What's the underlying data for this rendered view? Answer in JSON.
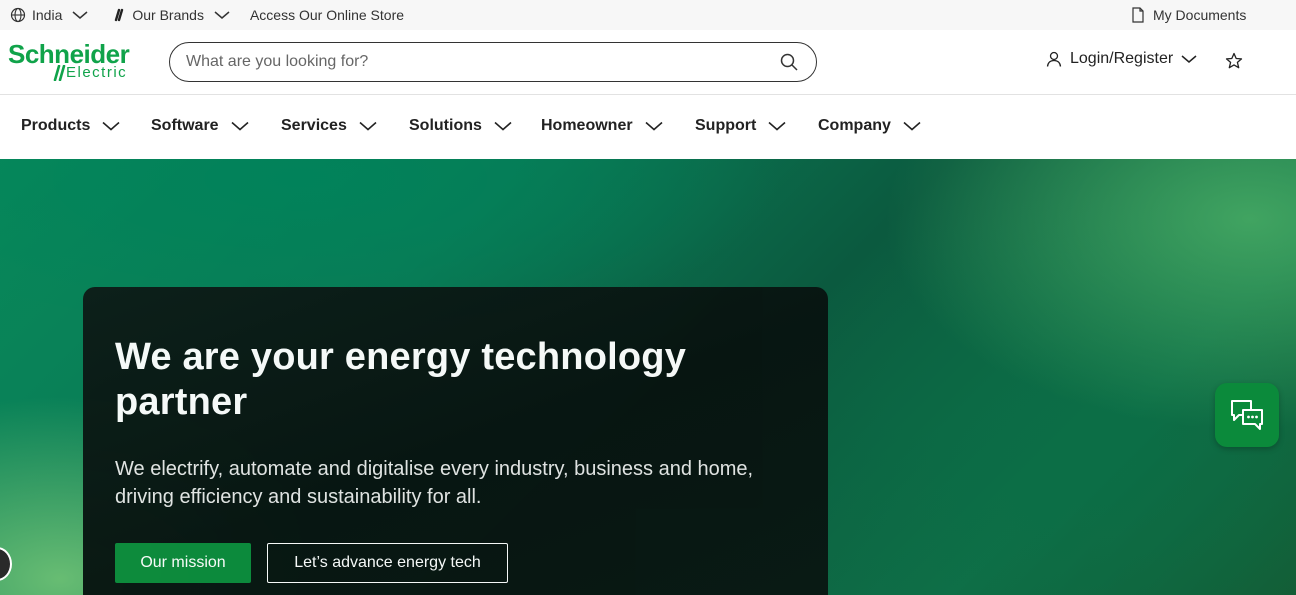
{
  "utility": {
    "country": "India",
    "brands": "Our Brands",
    "store": "Access Our Online Store",
    "documents": "My Documents"
  },
  "header": {
    "logo_line1": "Schneider",
    "logo_line2": "Electric",
    "search_placeholder": "What are you looking for?",
    "login": "Login/Register"
  },
  "nav": {
    "items": [
      "Products",
      "Software",
      "Services",
      "Solutions",
      "Homeowner",
      "Support",
      "Company"
    ]
  },
  "hero": {
    "title": "We are your energy technology partner",
    "subtitle": "We electrify, automate and digitalise every industry, business and home, driving efficiency and sustainability for all.",
    "primary_button": "Our mission",
    "secondary_button": "Let’s advance energy tech"
  },
  "icons": {
    "globe": "globe-icon",
    "brand": "brand-link-icon",
    "document": "document-icon",
    "search": "search-icon",
    "user": "user-icon",
    "star": "star-icon",
    "chat": "chat-icon",
    "chevron": "chevron-down-icon"
  },
  "colors": {
    "brand_green": "#10a34a",
    "button_green": "#0b8a3b"
  }
}
